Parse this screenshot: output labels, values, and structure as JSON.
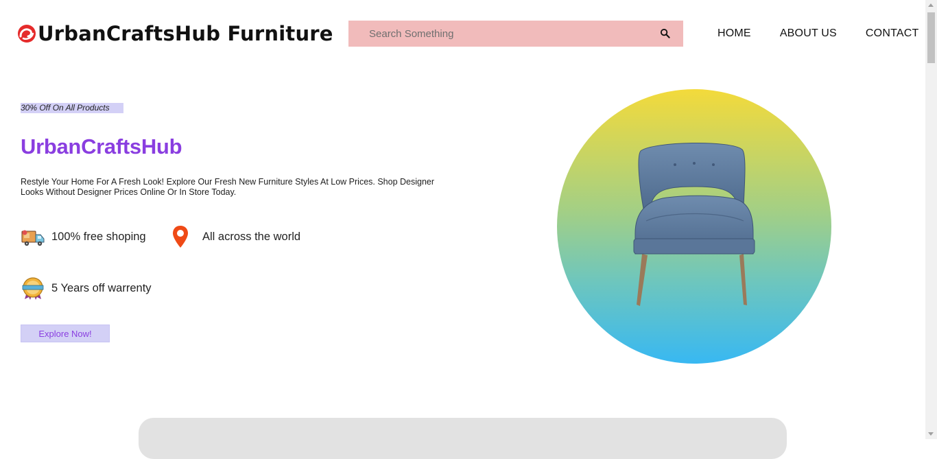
{
  "header": {
    "brand_name": "UrbanCraftsHub Furniture",
    "logo_icon": "brand-swirl-logo",
    "search": {
      "placeholder": "Search Something",
      "value": "",
      "icon": "search-icon"
    },
    "nav": {
      "home": "HOME",
      "about": "ABOUT US",
      "contact": "CONTACT"
    }
  },
  "hero": {
    "promo": "30% Off On All Products",
    "title": "UrbanCraftsHub",
    "description": "Restyle Your Home For A Fresh Look! Explore Our Fresh New Furniture Styles At Low Prices. Shop Designer Looks Without Designer Prices Online Or In Store Today.",
    "features": [
      {
        "icon": "delivery-truck-icon",
        "text": "100% free shoping"
      },
      {
        "icon": "location-pin-icon",
        "text": "All across the world"
      },
      {
        "icon": "warranty-badge-icon",
        "text": "5 Years off warrenty"
      }
    ],
    "cta": "Explore Now!",
    "image": "armchair-photo"
  },
  "colors": {
    "accent_purple": "#8a3ee0",
    "promo_bg": "#d3d0f6",
    "search_bg": "#f1bbbb",
    "circle_top": "#f3da3b",
    "circle_bottom": "#38b8f2"
  }
}
